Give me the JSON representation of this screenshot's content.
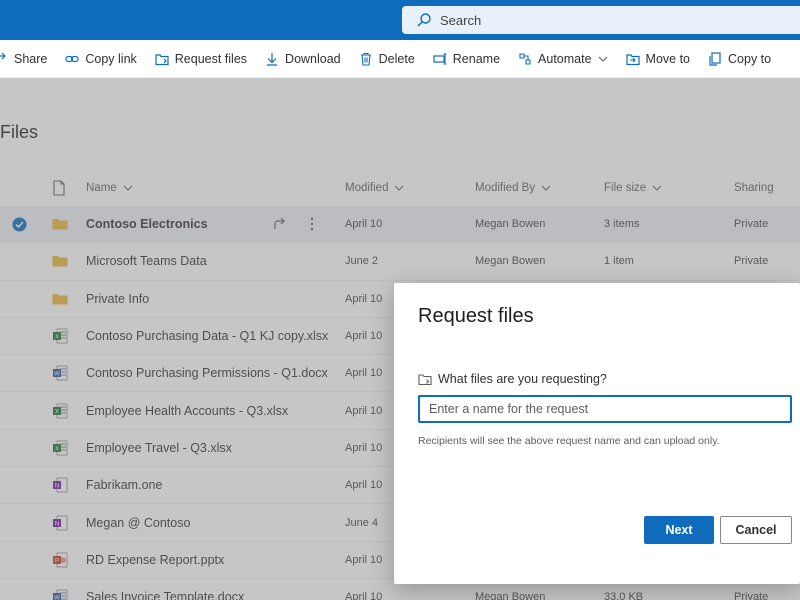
{
  "search": {
    "placeholder": "Search"
  },
  "commands": [
    {
      "label": "Share",
      "icon": "share-icon"
    },
    {
      "label": "Copy link",
      "icon": "link-icon"
    },
    {
      "label": "Request files",
      "icon": "request-files-icon"
    },
    {
      "label": "Download",
      "icon": "download-icon"
    },
    {
      "label": "Delete",
      "icon": "delete-icon"
    },
    {
      "label": "Rename",
      "icon": "rename-icon"
    },
    {
      "label": "Automate",
      "icon": "automate-icon"
    },
    {
      "label": "Move to",
      "icon": "move-to-icon"
    },
    {
      "label": "Copy to",
      "icon": "copy-to-icon"
    }
  ],
  "page": {
    "title": "Files"
  },
  "columns": {
    "name": "Name",
    "modified": "Modified",
    "modified_by": "Modified By",
    "file_size": "File size",
    "sharing": "Sharing"
  },
  "rows": [
    {
      "name": "Contoso Electronics",
      "type": "folder",
      "modified": "April 10",
      "modified_by": "Megan Bowen",
      "file_size": "3 items",
      "sharing": "Private",
      "selected": true
    },
    {
      "name": "Microsoft Teams Data",
      "type": "folder",
      "modified": "June 2",
      "modified_by": "Megan Bowen",
      "file_size": "1 item",
      "sharing": "Private"
    },
    {
      "name": "Private Info",
      "type": "folder",
      "modified": "April 10"
    },
    {
      "name": "Contoso Purchasing Data - Q1 KJ copy.xlsx",
      "type": "excel",
      "modified": "April 10"
    },
    {
      "name": "Contoso Purchasing Permissions - Q1.docx",
      "type": "word",
      "modified": "April 10"
    },
    {
      "name": "Employee Health Accounts - Q3.xlsx",
      "type": "excel",
      "modified": "April 10"
    },
    {
      "name": "Employee Travel - Q3.xlsx",
      "type": "excel",
      "modified": "April 10"
    },
    {
      "name": "Fabrikam.one",
      "type": "onenote",
      "modified": "April 10"
    },
    {
      "name": "Megan @ Contoso",
      "type": "onenote",
      "modified": "June 4"
    },
    {
      "name": "RD Expense Report.pptx",
      "type": "powerpoint",
      "modified": "April 10"
    },
    {
      "name": "Sales Invoice Template.docx",
      "type": "word",
      "modified": "April 10",
      "modified_by": "Megan Bowen",
      "file_size": "33.0 KB",
      "sharing": "Private"
    }
  ],
  "dialog": {
    "title": "Request files",
    "label": "What files are you requesting?",
    "input_placeholder": "Enter a name for the request",
    "note": "Recipients will see the above request name and can upload only.",
    "next_label": "Next",
    "cancel_label": "Cancel"
  },
  "colors": {
    "accent": "#0f6cbd",
    "folder": "#e8b93a",
    "excel": "#1d6f42",
    "word": "#2b579a",
    "onenote": "#7719aa",
    "powerpoint": "#c43e1c"
  }
}
